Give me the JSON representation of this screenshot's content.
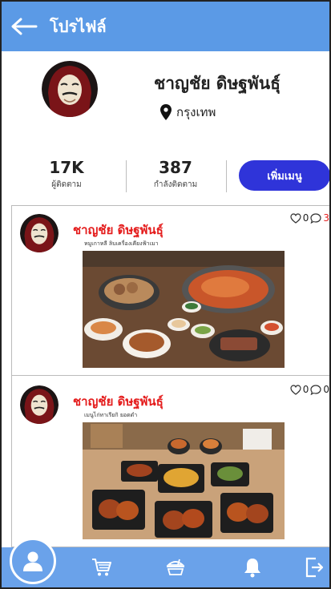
{
  "header": {
    "back_icon": "arrow-left-icon",
    "title": "โปรไฟล์"
  },
  "profile": {
    "avatar_icon": "masked-person-avatar",
    "name": "ชาญชัย ดิษฐพันธุ์",
    "location_icon": "map-pin-icon",
    "location": "กรุงเทพ"
  },
  "stats": {
    "followers": {
      "value": "17K",
      "label": "ผู้ติดตาม"
    },
    "following": {
      "value": "387",
      "label": "กำลังติดตาม"
    },
    "add_menu_label": "เพิ่มเมนู"
  },
  "posts": [
    {
      "author": "ชาญชัย ดิษฐพันธุ์",
      "caption": "หมูเกาหลี ลิบเครื่องเคียงฟ้าเมา",
      "likes": "0",
      "comments": "3",
      "comments_color": "#e41b1b"
    },
    {
      "author": "ชาญชัย ดิษฐพันธุ์",
      "caption": "เมนูไก่ทาเรียกิ ยอดดำ",
      "likes": "0",
      "comments": "0",
      "comments_color": "#222222"
    }
  ],
  "bottom_nav": {
    "items": [
      "profile-icon",
      "cart-icon",
      "food-icon",
      "bell-icon",
      "logout-icon"
    ]
  },
  "colors": {
    "header": "#5b9ae6",
    "nav": "#6aa2ea",
    "accent_button": "#2f34d9",
    "author_name": "#e41b1b"
  }
}
